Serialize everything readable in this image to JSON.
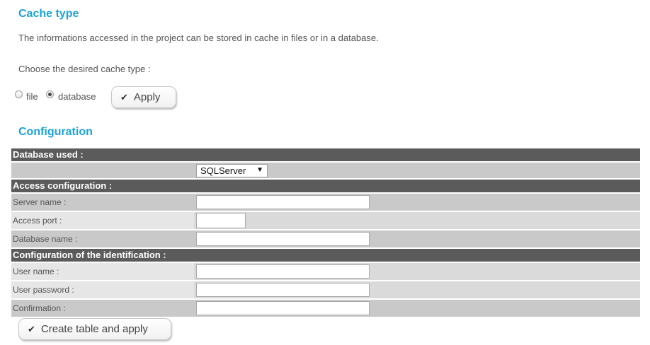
{
  "cache_section": {
    "title": "Cache type",
    "description": "The informations accessed in the project can be stored in cache in files or in a database.",
    "prompt": "Choose the desired cache type :",
    "options": [
      {
        "label": "file",
        "selected": false
      },
      {
        "label": "database",
        "selected": true
      }
    ],
    "apply_label": "Apply"
  },
  "config_section": {
    "title": "Configuration",
    "database_header": "Database used :",
    "database_select_value": "SQLServer",
    "access_header": "Access configuration :",
    "server_name_label": "Server name :",
    "server_name_value": "",
    "access_port_label": "Access port :",
    "access_port_value": "",
    "database_name_label": "Database name :",
    "database_name_value": "",
    "identification_header": "Configuration of the identification :",
    "user_name_label": "User name :",
    "user_name_value": "",
    "user_password_label": "User password :",
    "user_password_value": "",
    "confirmation_label": "Confirmation :",
    "confirmation_value": "",
    "create_button_label": "Create table and apply"
  },
  "icons": {
    "check": "check-icon",
    "dropdown": "triangle-down-icon"
  },
  "colors": {
    "section_title": "#1aa3d9",
    "header_bar": "#5b5b5b",
    "row_light": "#e6e6e6",
    "row_dark": "#c9c9c9"
  }
}
